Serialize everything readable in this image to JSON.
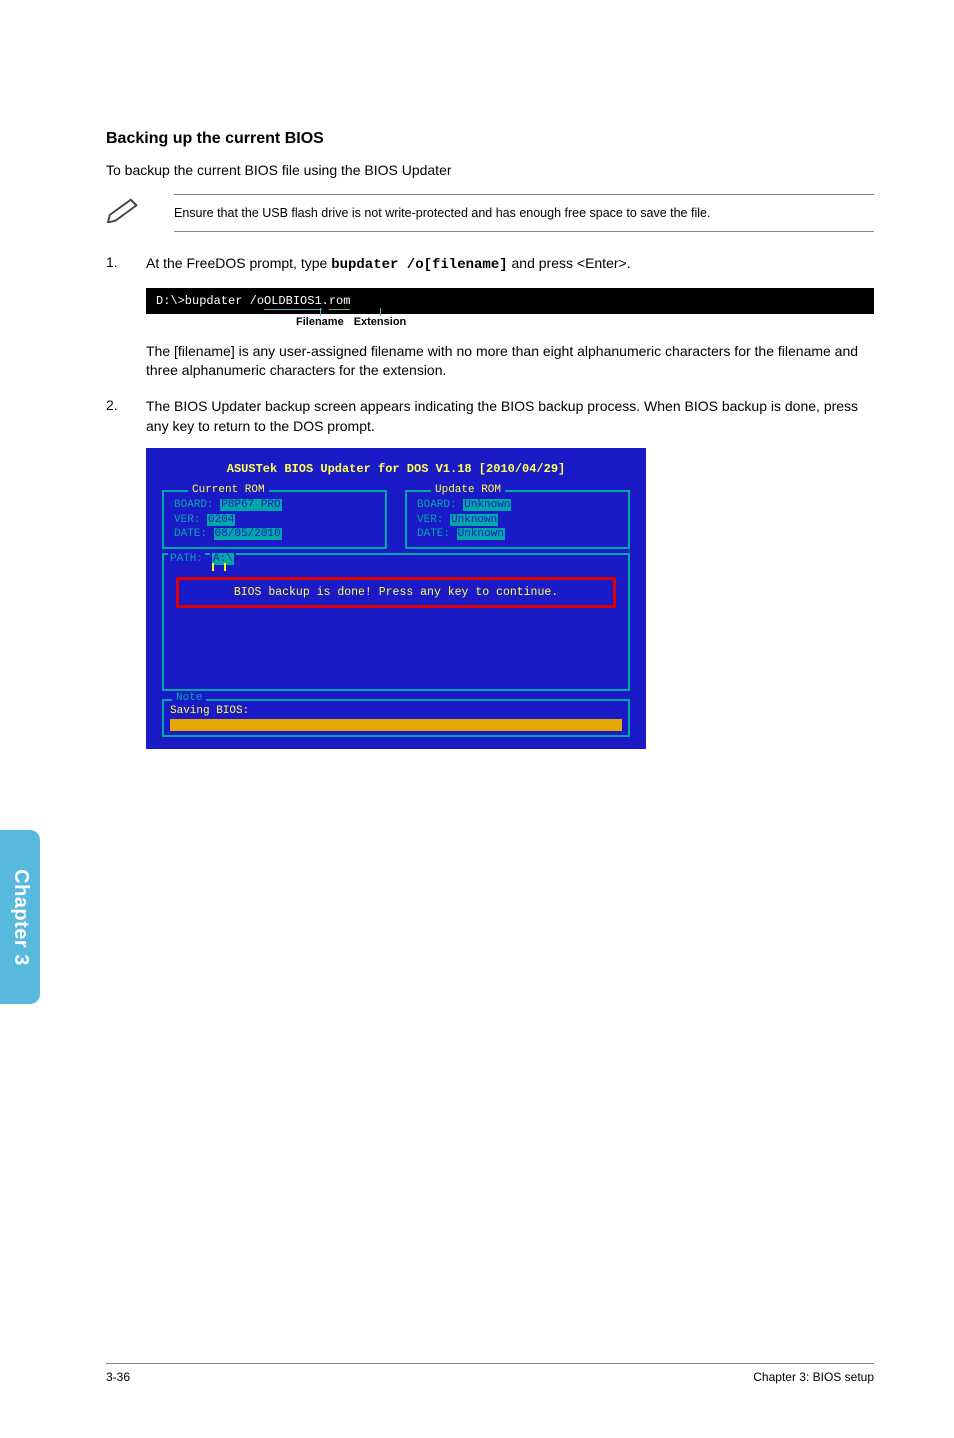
{
  "heading": "Backing up the current BIOS",
  "intro": "To backup the current BIOS file using the BIOS Updater",
  "note1": "Ensure that the USB flash drive is not write-protected and has enough free space to save the file.",
  "step1": {
    "num": "1.",
    "pre": "At the FreeDOS prompt, type ",
    "cmd": "bupdater /o[filename]",
    "post": " and press <Enter>."
  },
  "blackbox": {
    "prefix": "D:\\>bupdater /o",
    "fname": "OLDBIOS1",
    "dot": ".",
    "ext": "rom"
  },
  "labels": {
    "filename": "Filename",
    "extension": "Extension"
  },
  "indent": "The [filename] is any user-assigned filename with no more than eight alphanumeric characters for the filename and three alphanumeric characters for the extension.",
  "step2": {
    "num": "2.",
    "text": "The BIOS Updater backup screen appears indicating the BIOS backup process. When BIOS backup is done, press any key to return to the DOS prompt."
  },
  "bios": {
    "title": "ASUSTek BIOS Updater for DOS V1.18 [2010/04/29]",
    "current": {
      "legend": "Current ROM",
      "board_lbl": "BOARD: ",
      "board_val": "P8P67 PRO",
      "ver_lbl": "VER: ",
      "ver_val": "0204",
      "date_lbl": "DATE: ",
      "date_val": "08/05/2010"
    },
    "update": {
      "legend": "Update ROM",
      "board_lbl": "BOARD: ",
      "board_val": "Unknown",
      "ver_lbl": "VER: ",
      "ver_val": "Unknown",
      "date_lbl": "DATE: ",
      "date_val": "Unknown"
    },
    "path_lbl": "PATH: ",
    "path_val": "A:\\",
    "banner": "BIOS backup is done! Press any key to continue.",
    "note_legend": "Note",
    "saving": "Saving BIOS:"
  },
  "sidetab": "Chapter 3",
  "footer": {
    "left": "3-36",
    "right": "Chapter 3: BIOS setup"
  }
}
